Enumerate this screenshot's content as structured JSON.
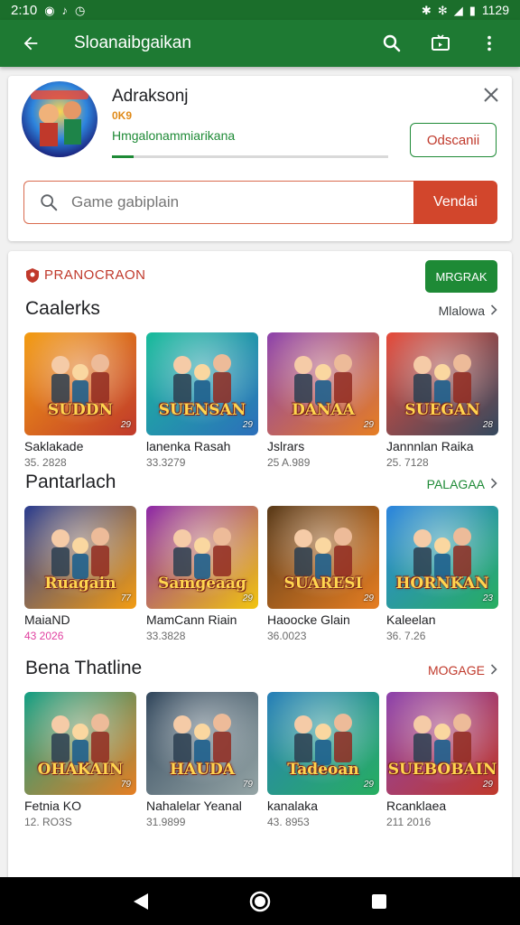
{
  "status": {
    "time": "2:10",
    "right_time": "1129"
  },
  "app_bar": {
    "title": "Sloanaibgaikan"
  },
  "app_card": {
    "name": "Adraksonj",
    "rating": "0K9",
    "progress_label": "Hmgalonammiarikana",
    "progress_percent": 8,
    "open_label": "Odscanii",
    "search": {
      "placeholder": "Game gabiplain",
      "button": "Vendai"
    }
  },
  "list_card": {
    "badge": "PRANOCRAON",
    "badge_button": "MRGRAK",
    "sections": [
      {
        "title": "Caalerks",
        "more": "Mlalowa",
        "more_color": "#3c4043",
        "items": [
          {
            "name": "Saklakade",
            "meta": "35. 2828",
            "art": "SUDDN",
            "badge": "29",
            "c1": "#f39c12",
            "c2": "#c0392b"
          },
          {
            "name": "lanenka Rasah",
            "meta": "33.3279",
            "art": "SUENSAN",
            "badge": "29",
            "c1": "#1abc9c",
            "c2": "#2c6fbb"
          },
          {
            "name": "Jslrars",
            "meta": "25 A.989",
            "art": "DANAA",
            "badge": "29",
            "c1": "#8e44ad",
            "c2": "#e67e22"
          },
          {
            "name": "Jannnlan Raika",
            "meta": "25. 7128",
            "art": "SUEGAN",
            "badge": "28",
            "c1": "#e74c3c",
            "c2": "#34495e"
          }
        ]
      },
      {
        "title": "Pantarlach",
        "more": "PALAGAA",
        "more_color": "#1e8a36",
        "items": [
          {
            "name": "MaiaND",
            "meta": "43 2026",
            "meta_color": "#e040a0",
            "art": "Ruagain",
            "badge": "77",
            "c1": "#2c3e90",
            "c2": "#f39c12"
          },
          {
            "name": "MamCann Riain",
            "meta": "33.3828",
            "art": "Samgeaag",
            "badge": "29",
            "c1": "#8e2aa8",
            "c2": "#f1c40f"
          },
          {
            "name": "Haoocke Glain",
            "meta": "36.0023",
            "art": "SUARESI",
            "badge": "29",
            "c1": "#5a3b1a",
            "c2": "#e67e22"
          },
          {
            "name": "Kaleelan",
            "meta": "36. 7.26",
            "art": "HORNKAN",
            "badge": "23",
            "c1": "#2e86de",
            "c2": "#27ae60"
          }
        ]
      },
      {
        "title": "Bena Thatline",
        "more": "MOGAGE",
        "more_color": "#c0392b",
        "items": [
          {
            "name": "Fetnia KO",
            "meta": "12. RO3S",
            "art": "OHAKAIN",
            "badge": "79",
            "c1": "#16a085",
            "c2": "#e67e22"
          },
          {
            "name": "Nahalelar Yeanal",
            "meta": "31.9899",
            "art": "HAUDA",
            "badge": "79",
            "c1": "#34495e",
            "c2": "#95a5a6"
          },
          {
            "name": "kanalaka",
            "meta": "43. 8953",
            "art": "Tadeoan",
            "badge": "29",
            "c1": "#2980b9",
            "c2": "#27ae60"
          },
          {
            "name": "Rcanklaea",
            "meta": "211 2016",
            "art": "SUEBOBAIN",
            "badge": "29",
            "c1": "#8e44ad",
            "c2": "#c0392b"
          }
        ]
      }
    ]
  },
  "colors": {
    "green": "#1e7a33",
    "accent_red": "#d2462c"
  }
}
